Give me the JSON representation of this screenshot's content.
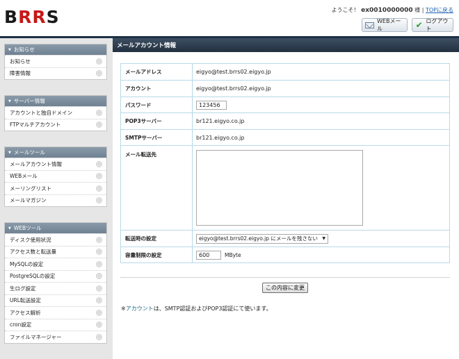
{
  "header": {
    "logo_b": "B",
    "logo_rr": "RR",
    "logo_s": "S",
    "welcome": "ようこそ！",
    "user_id": "ex0010000000",
    "honorific": "様",
    "separator": "|",
    "top_link": "TOPに戻る",
    "web_mail_label": "WEBメール",
    "logout_label": "ログアウト"
  },
  "sidebar": {
    "sections": [
      {
        "title": "お知らせ",
        "items": [
          "お知らせ",
          "障害情報"
        ]
      },
      {
        "title": "サーバー情報",
        "items": [
          "アカウントと独自ドメイン",
          "FTPマルチアカウント"
        ]
      },
      {
        "title": "メールツール",
        "items": [
          "メールアカウント情報",
          "WEBメール",
          "メーリングリスト",
          "メールマガジン"
        ]
      },
      {
        "title": "WEBツール",
        "items": [
          "ディスク使用状況",
          "アクセス数と転送量",
          "MySQLの設定",
          "PostgreSQLの設定",
          "生ログ設定",
          "URL転送設定",
          "アクセス解析",
          "cron設定",
          "ファイルマネージャー"
        ]
      }
    ]
  },
  "main": {
    "title": "メールアカウント情報",
    "rows": {
      "mail_address_label": "メールアドレス",
      "mail_address": "eigyo@test.brrs02.eigyo.jp",
      "account_label": "アカウント",
      "account": "eigyo@test.brrs02.eigyo.jp",
      "password_label": "パスワード",
      "password": "123456",
      "pop3_label": "POP3サーバー",
      "pop3": "br121.eigyo.co.jp",
      "smtp_label": "SMTPサーバー",
      "smtp": "br121.eigyo.co.jp",
      "forward_label": "メール転送先",
      "forward_value": "",
      "forward_setting_label": "転送時の設定",
      "forward_setting": "eigyo@test.brrs02.eigyo.jp にメールを残さない",
      "quota_label": "容量制限の設定",
      "quota": "600",
      "quota_unit": "MByte"
    },
    "submit_label": "この内容に変更",
    "note_prefix": "※",
    "note_link": "アカウント",
    "note_text": "は、SMTP認証およびPOP3認証にて使います。"
  }
}
